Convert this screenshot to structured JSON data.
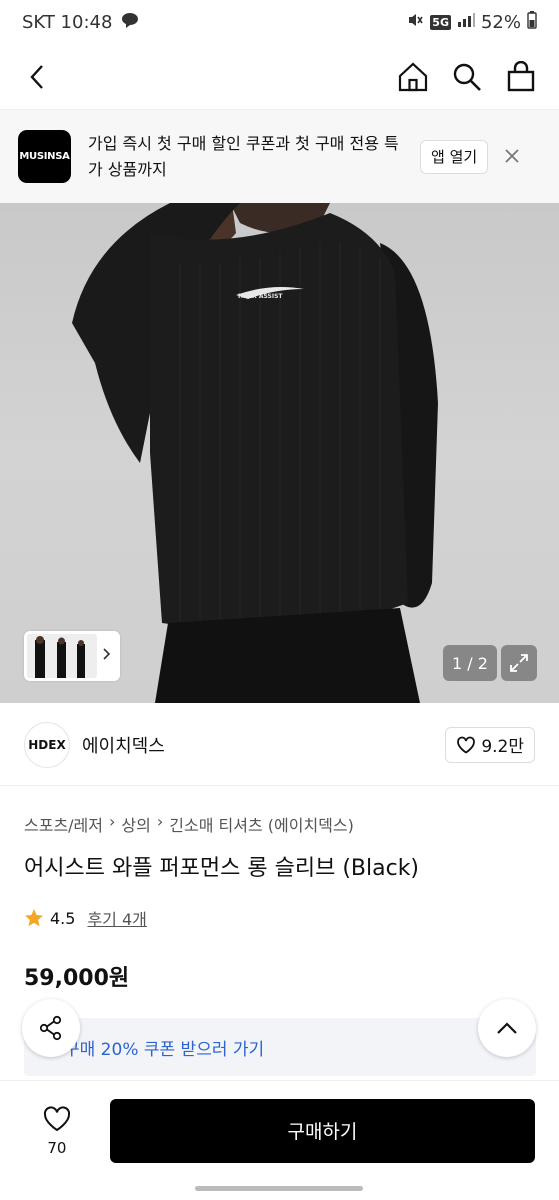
{
  "status": {
    "carrier_time": "SKT 10:48",
    "network": "5G",
    "battery": "52%"
  },
  "banner": {
    "logo_text": "MUSINSA",
    "message": "가입 즉시 첫 구매 할인 쿠폰과 첫 구매 전용 특가 상품까지",
    "open_label": "앱 열기"
  },
  "gallery": {
    "page_indicator": "1 / 2",
    "print_text": "HDEX ASSIST"
  },
  "brand": {
    "logo_text": "HDEX",
    "name": "에이치덱스",
    "likes": "9.2만"
  },
  "product": {
    "breadcrumb": [
      "스포츠/레저",
      "상의",
      "긴소매 티셔츠 (에이치덱스)"
    ],
    "title": "어시스트 와플 퍼포먼스 롱 슬리브 (Black)",
    "rating": "4.5",
    "reviews": "후기 4개",
    "price": "59,000원",
    "coupon": "구매 20% 쿠폰 받으러 가기"
  },
  "bottom": {
    "wish_count": "70",
    "buy_label": "구매하기"
  },
  "colors": {
    "accent_blue": "#2d63d1",
    "star": "#f5a623",
    "buy_button": "#000000"
  }
}
